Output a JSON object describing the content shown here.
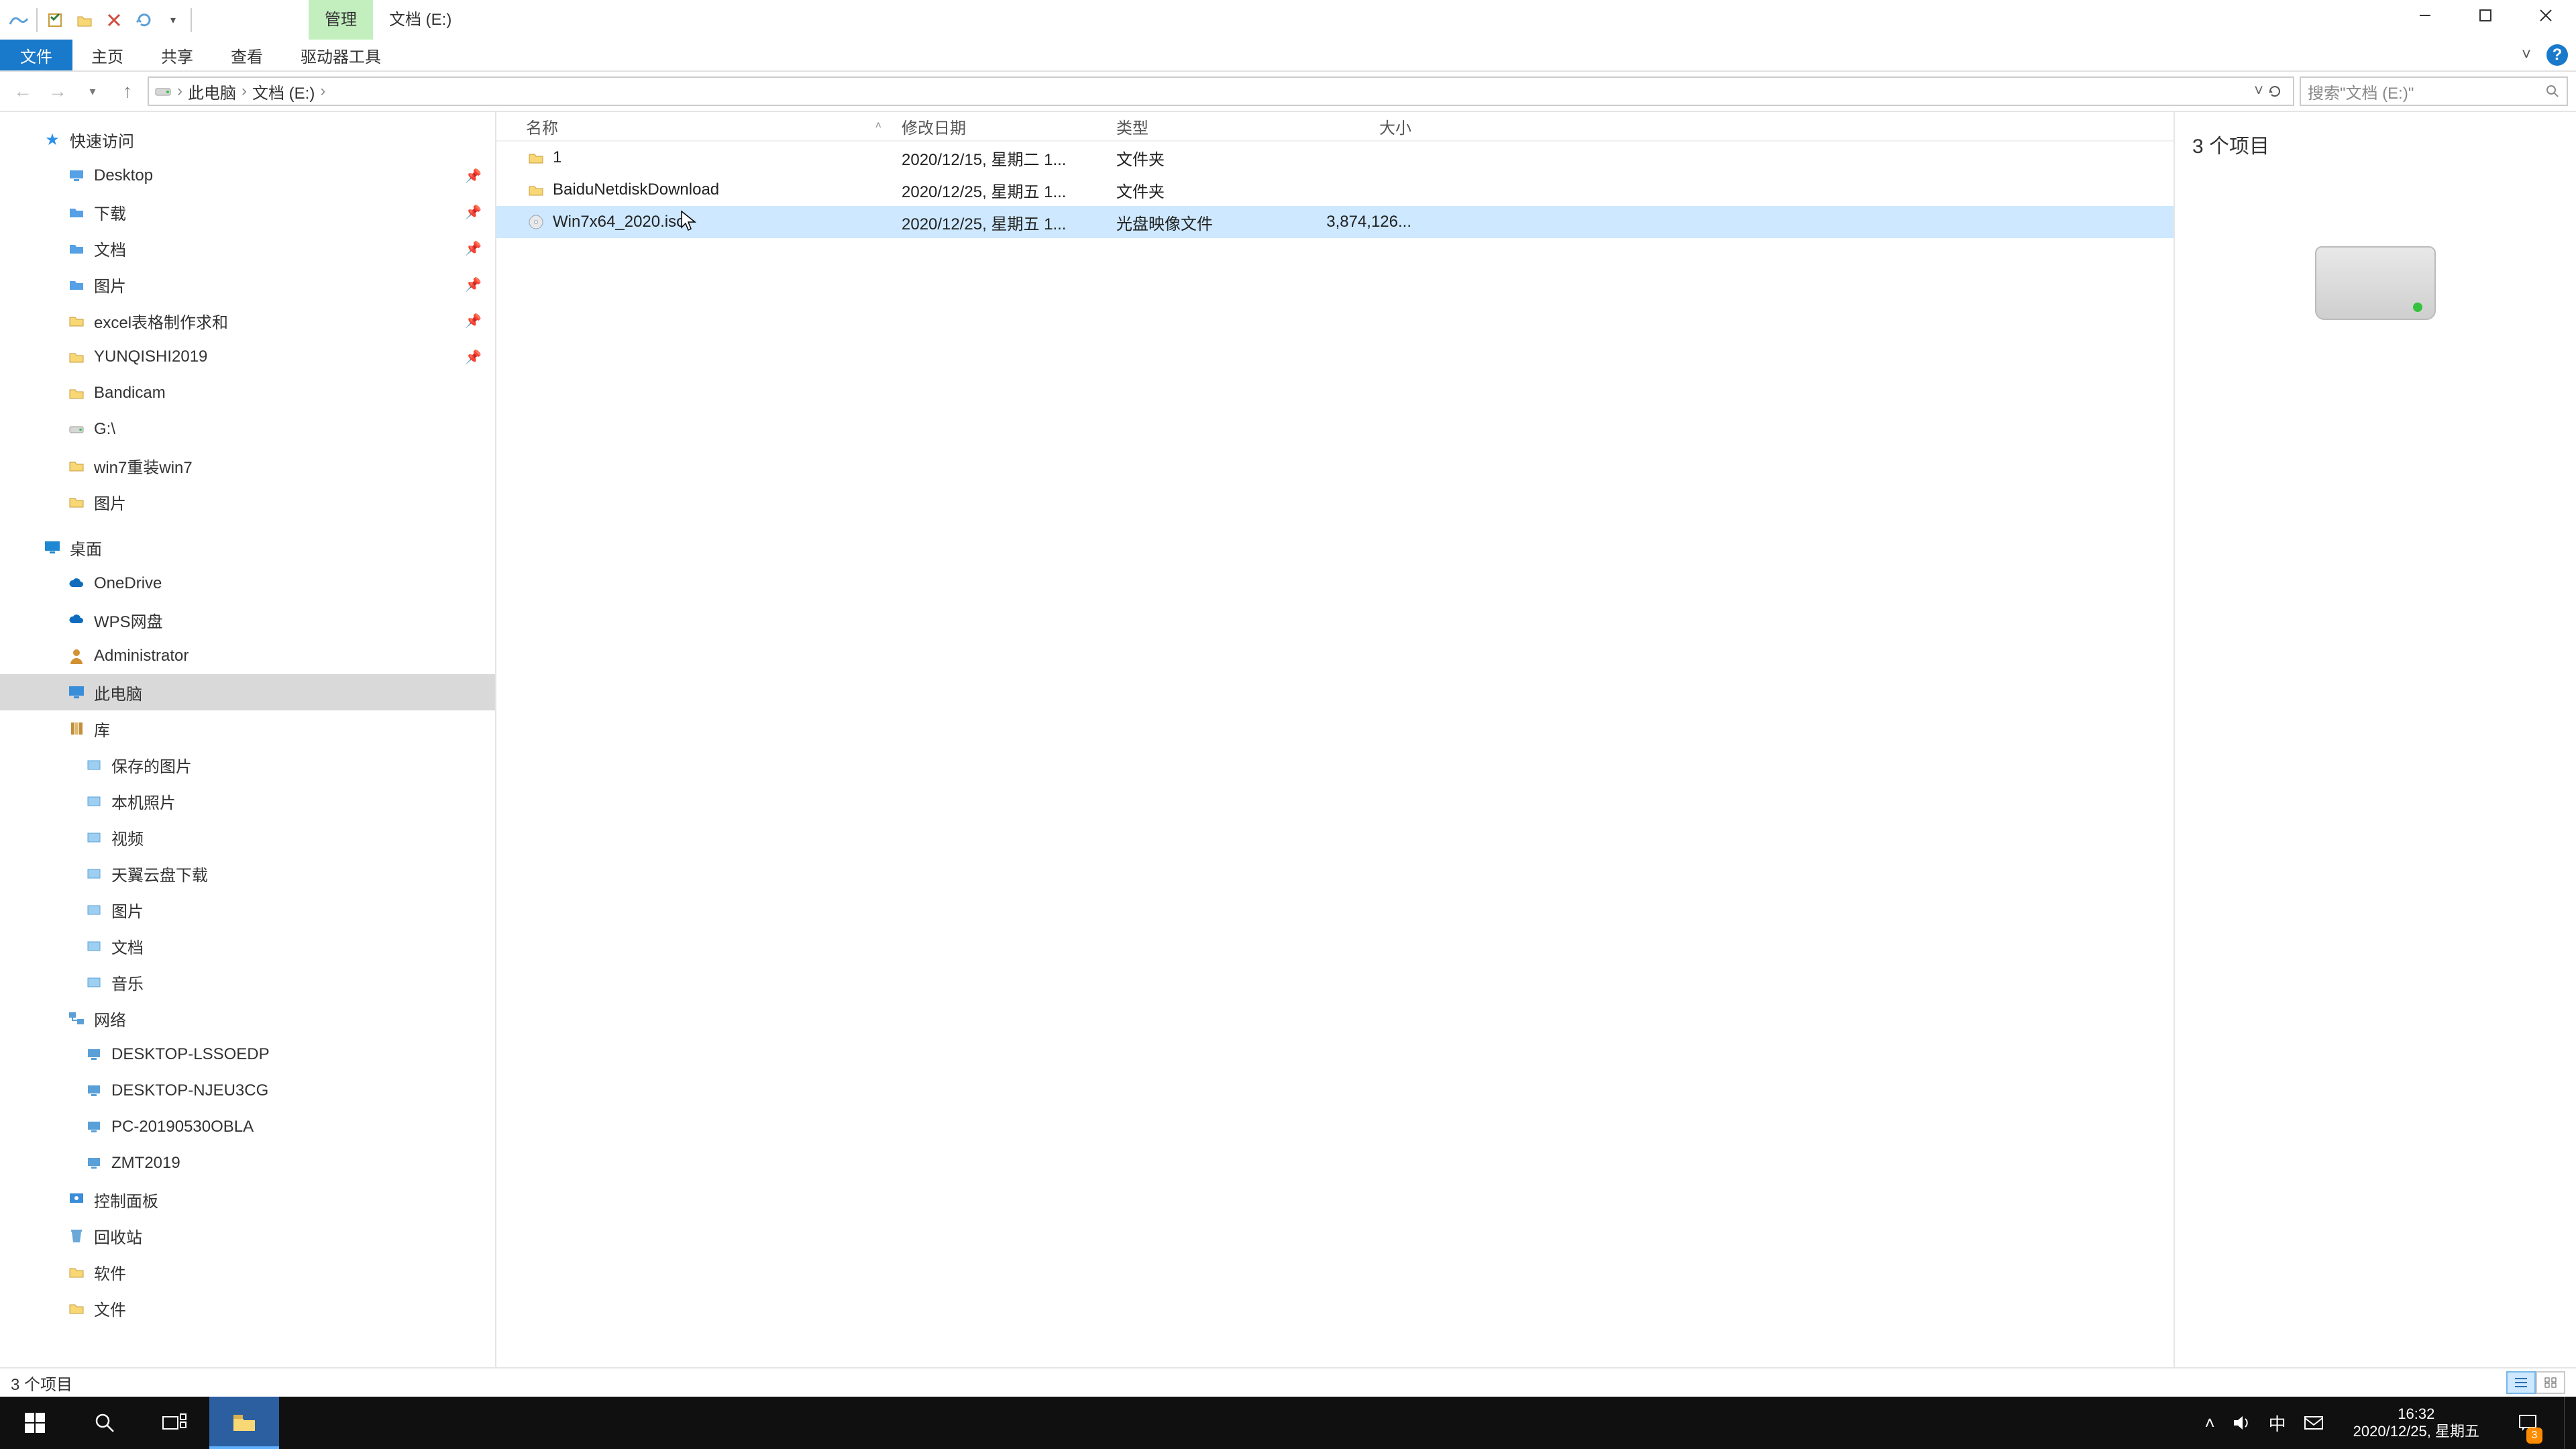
{
  "window": {
    "contextual_tab": "管理",
    "location_tab": "文档 (E:)",
    "min_tooltip": "最小化",
    "max_tooltip": "最大化",
    "close_tooltip": "关闭"
  },
  "ribbon": {
    "file": "文件",
    "home": "主页",
    "share": "共享",
    "view": "查看",
    "drive_tools": "驱动器工具"
  },
  "address": {
    "crumbs": [
      "此电脑",
      "文档 (E:)"
    ],
    "refresh_tooltip": "刷新",
    "search_placeholder": "搜索\"文档 (E:)\""
  },
  "nav": {
    "quick_access": "快速访问",
    "quick_items": [
      {
        "label": "Desktop",
        "icon": "desktop",
        "pinned": true
      },
      {
        "label": "下载",
        "icon": "folder-blue",
        "pinned": true
      },
      {
        "label": "文档",
        "icon": "folder-blue",
        "pinned": true
      },
      {
        "label": "图片",
        "icon": "folder-blue",
        "pinned": true
      },
      {
        "label": "excel表格制作求和",
        "icon": "folder",
        "pinned": true
      },
      {
        "label": "YUNQISHI2019",
        "icon": "folder",
        "pinned": true
      },
      {
        "label": "Bandicam",
        "icon": "folder",
        "pinned": false
      },
      {
        "label": "G:\\",
        "icon": "disk",
        "pinned": false
      },
      {
        "label": "win7重装win7",
        "icon": "folder",
        "pinned": false
      },
      {
        "label": "图片",
        "icon": "folder",
        "pinned": false
      }
    ],
    "desktop": "桌面",
    "desktop_items": [
      {
        "label": "OneDrive",
        "icon": "cloud"
      },
      {
        "label": "WPS网盘",
        "icon": "cloud"
      },
      {
        "label": "Administrator",
        "icon": "user"
      },
      {
        "label": "此电脑",
        "icon": "pc",
        "selected": true
      },
      {
        "label": "库",
        "icon": "lib"
      }
    ],
    "library_items": [
      {
        "label": "保存的图片"
      },
      {
        "label": "本机照片"
      },
      {
        "label": "视频"
      },
      {
        "label": "天翼云盘下载"
      },
      {
        "label": "图片"
      },
      {
        "label": "文档"
      },
      {
        "label": "音乐"
      }
    ],
    "network": "网络",
    "network_items": [
      {
        "label": "DESKTOP-LSSOEDP"
      },
      {
        "label": "DESKTOP-NJEU3CG"
      },
      {
        "label": "PC-20190530OBLA"
      },
      {
        "label": "ZMT2019"
      }
    ],
    "tail_items": [
      {
        "label": "控制面板",
        "icon": "panel"
      },
      {
        "label": "回收站",
        "icon": "recycle"
      },
      {
        "label": "软件",
        "icon": "folder"
      },
      {
        "label": "文件",
        "icon": "folder"
      }
    ]
  },
  "columns": {
    "name": "名称",
    "date": "修改日期",
    "type": "类型",
    "size": "大小"
  },
  "files": [
    {
      "name": "1",
      "date": "2020/12/15, 星期二 1...",
      "type": "文件夹",
      "size": "",
      "icon": "folder",
      "selected": false
    },
    {
      "name": "BaiduNetdiskDownload",
      "date": "2020/12/25, 星期五 1...",
      "type": "文件夹",
      "size": "",
      "icon": "folder",
      "selected": false
    },
    {
      "name": "Win7x64_2020.iso",
      "date": "2020/12/25, 星期五 1...",
      "type": "光盘映像文件",
      "size": "3,874,126...",
      "icon": "disc",
      "selected": true
    }
  ],
  "preview": {
    "title": "3 个项目"
  },
  "status": {
    "text": "3 个项目"
  },
  "taskbar": {
    "time": "16:32",
    "date": "2020/12/25, 星期五",
    "ime": "中",
    "notif_count": "3"
  }
}
